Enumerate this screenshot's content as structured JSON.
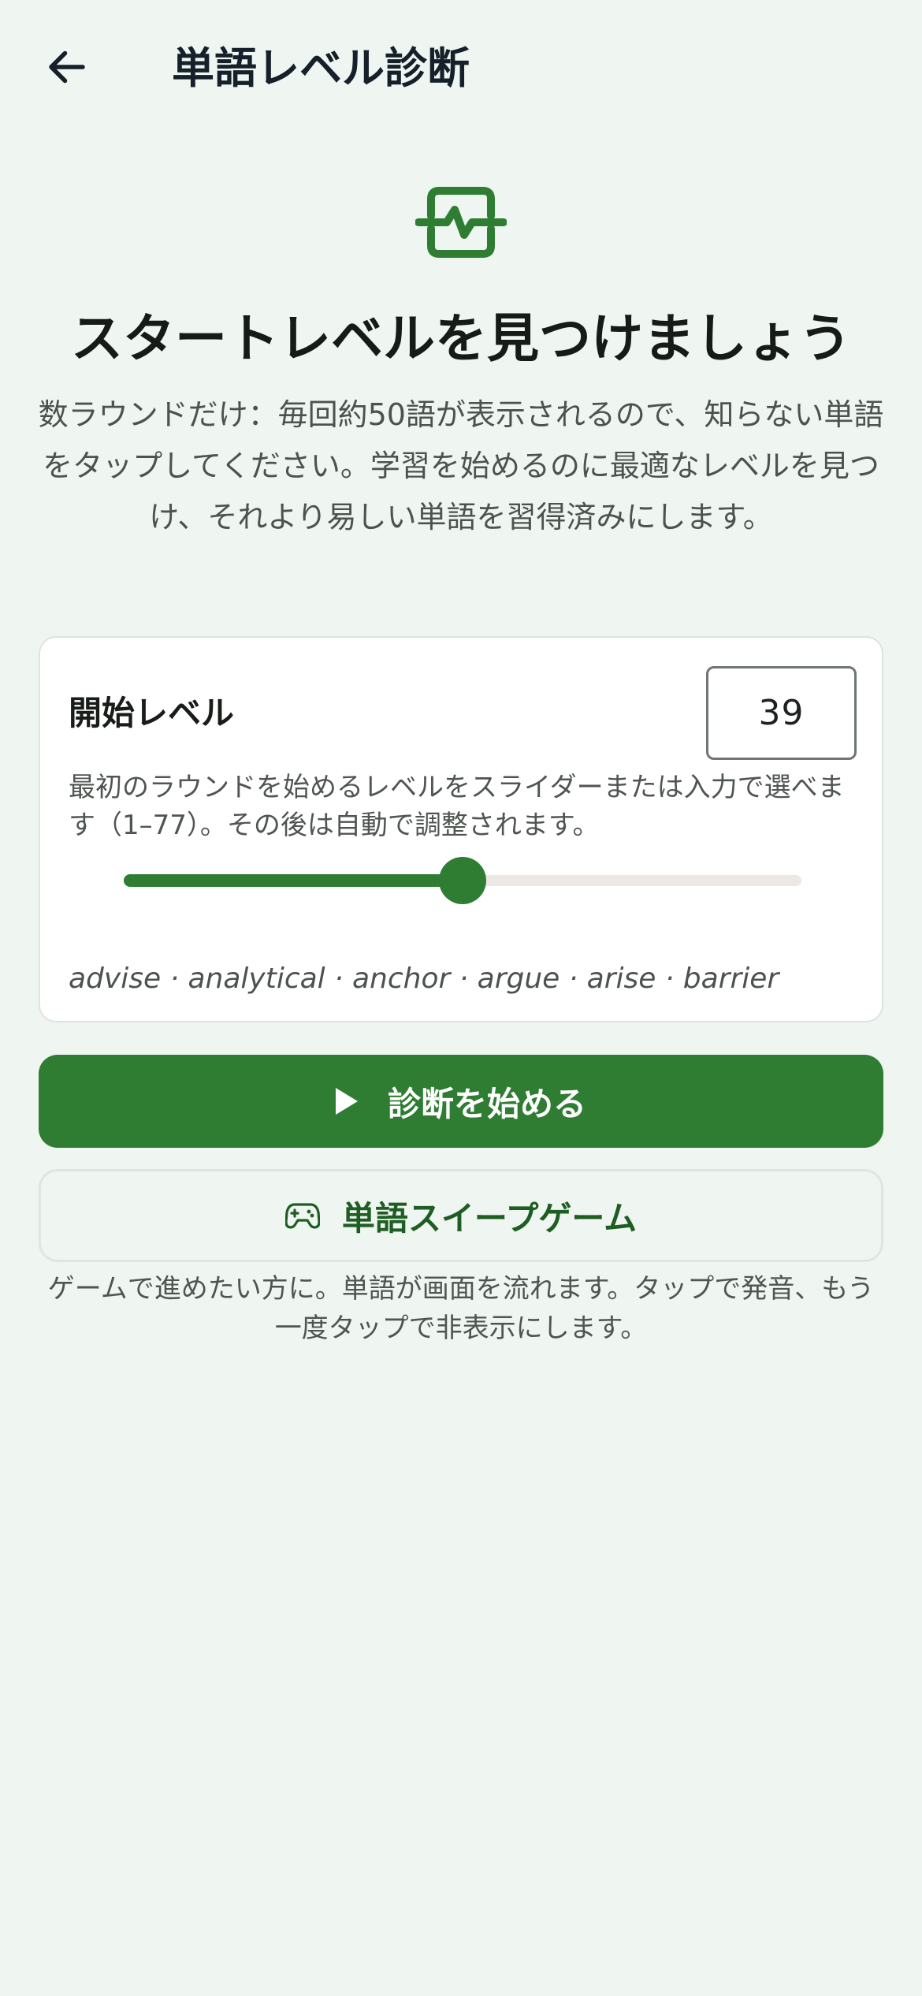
{
  "app_bar": {
    "back_icon": "arrow-left-icon",
    "title": "単語レベル診断"
  },
  "hero": {
    "icon": "activity-monitor-icon",
    "accent_color": "#2e7d32"
  },
  "headline": "スタートレベルを見つけましょう",
  "intro": "数ラウンドだけ：毎回約50語が表示されるので、知らない単語をタップしてください。学習を始めるのに最適なレベルを見つけ、それより易しい単語を習得済みにします。",
  "level_card": {
    "title": "開始レベル",
    "level_value": "39",
    "description": "最初のラウンドを始めるレベルをスライダーまたは入力で選べます（1–77）。その後は自動で調整されます。",
    "slider": {
      "min": 1,
      "max": 77,
      "value": 39
    },
    "sample_words": "advise · analytical · anchor · argue · arise · barrier"
  },
  "primary_button": {
    "icon": "play-icon",
    "label": "診断を始める"
  },
  "secondary_button": {
    "icon": "gamepad-icon",
    "label": "単語スイープゲーム"
  },
  "footnote": "ゲームで進めたい方に。単語が画面を流れます。タップで発音、もう一度タップで非表示にします。"
}
